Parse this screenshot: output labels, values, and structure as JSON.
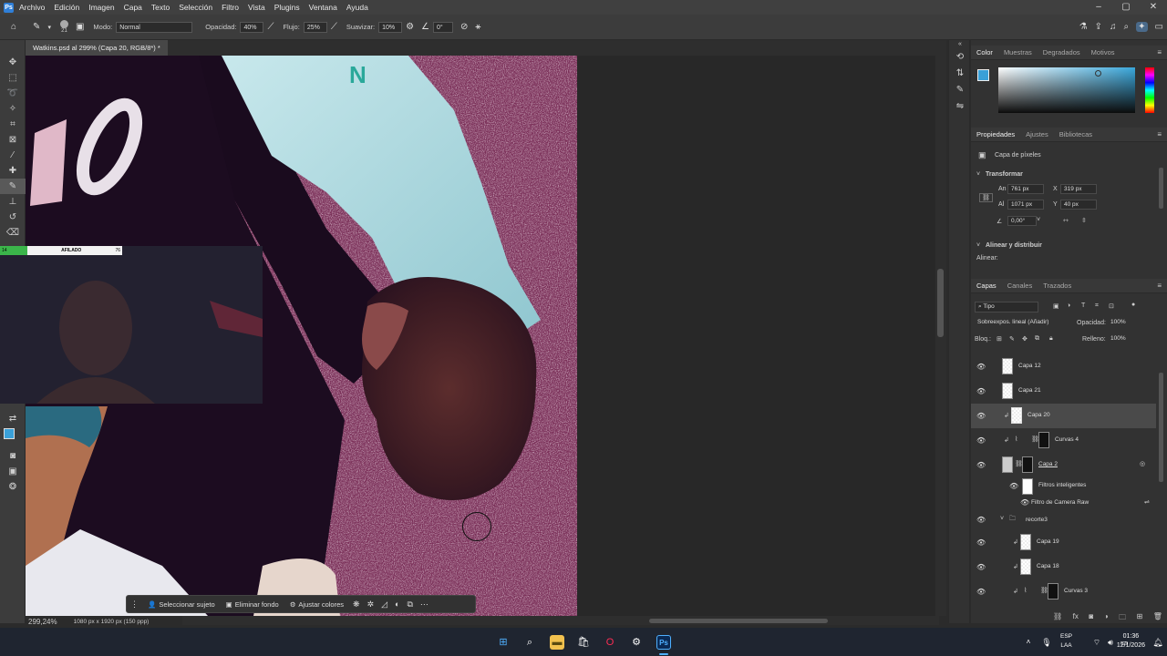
{
  "menubar": {
    "items": [
      "Archivo",
      "Edición",
      "Imagen",
      "Capa",
      "Texto",
      "Selección",
      "Filtro",
      "Vista",
      "Plugins",
      "Ventana",
      "Ayuda"
    ]
  },
  "options": {
    "mode_label": "Modo:",
    "mode_value": "Normal",
    "opacity_label": "Opacidad:",
    "opacity_value": "40%",
    "flow_label": "Flujo:",
    "flow_value": "25%",
    "smooth_label": "Suavizar:",
    "smooth_value": "10%",
    "angle_value": "0°",
    "brush_size": "21"
  },
  "document": {
    "tab_title": "Watkins.psd al 299% (Capa 20, RGB/8*) *",
    "zoom": "299,24%",
    "dimensions": "1080 px x 1920 px (150 ppp)"
  },
  "context_bar": {
    "select_subject": "Seleccionar sujeto",
    "remove_bg": "Eliminar fondo",
    "adjust_colors": "Ajustar colores"
  },
  "webcam": {
    "bar_left": "14",
    "bar_label": "AFILADO",
    "bar_right": "76"
  },
  "color_panel": {
    "tabs": [
      "Color",
      "Muestras",
      "Degradados",
      "Motivos"
    ],
    "fg_color": "#3aa0d8"
  },
  "properties": {
    "tabs": [
      "Propiedades",
      "Ajustes",
      "Bibliotecas"
    ],
    "layer_type": "Capa de píxeles",
    "transform_title": "Transformar",
    "w_label": "An",
    "w": "761 px",
    "h_label": "Al",
    "h": "1071 px",
    "x_label": "X",
    "x": "319 px",
    "y_label": "Y",
    "y": "40 px",
    "angle": "0,00°",
    "align_title": "Alinear y distribuir",
    "align_label": "Alinear:"
  },
  "layers_panel": {
    "tabs": [
      "Capas",
      "Canales",
      "Trazados"
    ],
    "filter_kind": "Tipo",
    "blend_mode": "Sobreexpos. lineal (Añadir)",
    "opacity_label": "Opacidad:",
    "opacity_value": "100%",
    "lock_label": "Bloq.:",
    "fill_label": "Relleno:",
    "fill_value": "100%",
    "layers": [
      {
        "name": "Capa 12"
      },
      {
        "name": "Capa 21"
      },
      {
        "name": "Capa 20"
      },
      {
        "name": "Curvas 4"
      },
      {
        "name": "Capa 2"
      },
      {
        "name": "Filtros inteligentes"
      },
      {
        "name": "Filtro de Camera Raw"
      },
      {
        "name": "recorte3"
      },
      {
        "name": "Capa 19"
      },
      {
        "name": "Capa 18"
      },
      {
        "name": "Curvas 3"
      }
    ]
  },
  "taskbar": {
    "lang_top": "ESP",
    "lang_bottom": "LAA",
    "time": "01:36",
    "date": "12/1/2026"
  }
}
